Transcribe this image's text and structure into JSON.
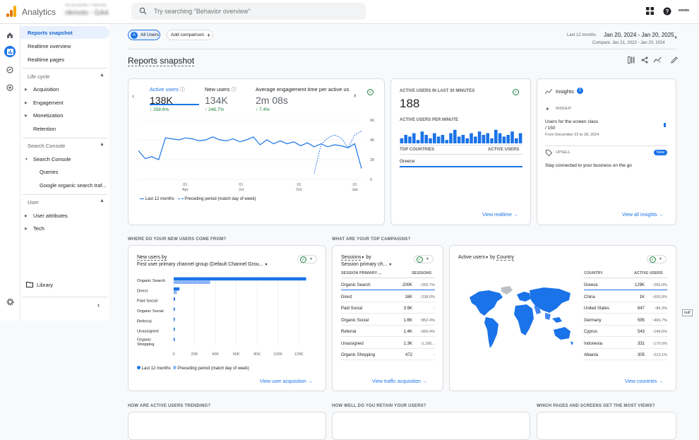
{
  "app": {
    "name": "Analytics",
    "account_line1": "All accounts > nkmoto",
    "account_line2": "nkmoto - GA4"
  },
  "search": {
    "placeholder": "Try searching \"Behavior overview\""
  },
  "topbar": {
    "brand": "emoto"
  },
  "sidebar": {
    "items": [
      "Reports snapshot",
      "Realtime overview",
      "Realtime pages"
    ],
    "sections": [
      {
        "title": "Life cycle",
        "items": [
          "Acquisition",
          "Engagement",
          "Monetization",
          "Retention"
        ]
      },
      {
        "title": "Search Console",
        "items": [
          "Search Console",
          "Queries",
          "Google organic search traf..."
        ]
      },
      {
        "title": "User",
        "items": [
          "User attributes",
          "Tech"
        ]
      }
    ],
    "library": "Library"
  },
  "header": {
    "chip_all_users": "All Users",
    "chip_avatar": "A",
    "add_comparison": "Add comparison",
    "range_label": "Last 12 months",
    "range_main": "Jan 20, 2024 - Jan 20, 2025",
    "range_compare": "Compare: Jan 21, 2023 - Jan 20, 2024",
    "title": "Reports snapshot"
  },
  "overview": {
    "metrics": [
      {
        "label": "Active users",
        "value": "138K",
        "change": "258.6%"
      },
      {
        "label": "New users",
        "value": "134K",
        "change": "248.7%"
      },
      {
        "label": "Average engagement time per active us",
        "value": "2m 08s",
        "change": "7.4%"
      }
    ],
    "legend": [
      "Last 12 months",
      "Preceding period (match day of week)"
    ]
  },
  "chart_data": [
    {
      "type": "line",
      "title": "",
      "series": [
        {
          "name": "Last 12 months",
          "values": [
            2.9,
            2.1,
            2.3,
            2.0,
            4.2,
            4.1,
            4.0,
            4.2,
            4.1,
            3.9,
            4.0,
            4.3,
            4.0,
            3.9,
            4.1,
            3.8,
            4.0,
            4.3,
            3.5,
            4.0,
            3.6,
            3.9,
            3.6,
            3.8,
            3.4,
            3.7,
            3.3,
            3.6,
            3.3,
            3.5,
            3.4,
            3.2,
            3.6,
            1.1
          ]
        },
        {
          "name": "Preceding period (match day of week)",
          "values": [
            null,
            null,
            null,
            null,
            null,
            null,
            null,
            null,
            null,
            null,
            null,
            null,
            null,
            null,
            null,
            null,
            null,
            null,
            null,
            null,
            null,
            null,
            null,
            null,
            null,
            null,
            0.6,
            3.5,
            4.2,
            4.5,
            4.2,
            3.2,
            4.5,
            4.9
          ]
        }
      ],
      "x_ticks": [
        {
          "line1": "01",
          "line2": "Apr"
        },
        {
          "line1": "01",
          "line2": "Jul"
        },
        {
          "line1": "01",
          "line2": "Oct"
        },
        {
          "line1": "01",
          "line2": "Jan"
        }
      ],
      "y_ticks": [
        "6K",
        "4K",
        "2K",
        "0"
      ],
      "ylim": [
        0,
        6
      ]
    },
    {
      "type": "bar",
      "title": "",
      "categories": [
        "Organic Search",
        "Direct",
        "Paid Social",
        "Organic Social",
        "Referral",
        "Unassigned",
        "Organic Shopping"
      ],
      "series": [
        {
          "name": "Last 12 months",
          "values": [
            127000,
            5500,
            1300,
            1100,
            700,
            600,
            300
          ]
        },
        {
          "name": "Preceding period (match day of week)",
          "values": [
            35000,
            3000,
            0,
            0,
            0,
            0,
            0
          ]
        }
      ],
      "x_ticks": [
        "0",
        "20K",
        "40K",
        "60K",
        "80K",
        "100K",
        "120K"
      ],
      "xlim": [
        0,
        130000
      ]
    },
    {
      "type": "bar",
      "title": "",
      "values": [
        3,
        5,
        4,
        6,
        2,
        7,
        5,
        3,
        6,
        4,
        5,
        2,
        6,
        8,
        4,
        5,
        3,
        6,
        4,
        7,
        5,
        6,
        3,
        8,
        6,
        4,
        5,
        7,
        3,
        6
      ],
      "ylim": [
        0,
        10
      ]
    }
  ],
  "realtime": {
    "title": "ACTIVE USERS IN LAST 30 MINUTES",
    "value": "188",
    "per_minute": "ACTIVE USERS PER MINUTE",
    "col1": "TOP COUNTRIES",
    "col2": "ACTIVE USERS",
    "country": "Greece",
    "link": "View realtime"
  },
  "insights": {
    "title": "Insights",
    "badge": "1",
    "insight_label": "INSIGHT",
    "insight_text": "Users for the screen class",
    "insight_value": "/ 150",
    "insight_date": "From December 22 to 28, 2024",
    "upsell_label": "UPSELL",
    "new_badge": "New",
    "upsell_text": "Stay connected to your business on the go",
    "link": "View all insights"
  },
  "new_users": {
    "section": "WHERE DO YOUR NEW USERS COME FROM?",
    "title": "New users by",
    "subtitle": "First user primary channel group (Default Channel Grou...",
    "link": "View user acquisition"
  },
  "campaigns": {
    "section": "WHAT ARE YOUR TOP CAMPAIGNS?",
    "title": "Sessions",
    "by": "by",
    "subtitle": "Session primary ch...",
    "col1": "SESSION PRIMARY ...",
    "col2": "SESSIONS",
    "rows": [
      {
        "name": "Organic Search",
        "value": "200K",
        "change": "265.7%"
      },
      {
        "name": "Direct",
        "value": "16K",
        "change": "238.0%"
      },
      {
        "name": "Paid Social",
        "value": "3.9K",
        "change": "-"
      },
      {
        "name": "Organic Social",
        "value": "1.6K",
        "change": "852.4%"
      },
      {
        "name": "Referral",
        "value": "1.4K",
        "change": "950.4%"
      },
      {
        "name": "Unassigned",
        "value": "1.3K",
        "change": "1,180..."
      },
      {
        "name": "Organic Shopping",
        "value": "472",
        "change": "-"
      }
    ],
    "link": "View traffic acquisition"
  },
  "countries": {
    "title": "Active users",
    "by": "by",
    "dim": "Country",
    "col1": "COUNTRY",
    "col2": "ACTIVE USERS",
    "rows": [
      {
        "name": "Greece",
        "value": "129K",
        "change": "265.0%"
      },
      {
        "name": "China",
        "value": "1K",
        "change": "655.9%"
      },
      {
        "name": "United States",
        "value": "647",
        "change": "86.3%"
      },
      {
        "name": "Germany",
        "value": "595",
        "change": "466.7%"
      },
      {
        "name": "Cyprus",
        "value": "543",
        "change": "146.6%"
      },
      {
        "name": "Indonesia",
        "value": "331",
        "change": "170.0%"
      },
      {
        "name": "Albania",
        "value": "305",
        "change": "213.1%"
      }
    ],
    "link": "View countries"
  },
  "bottom": {
    "s1": "HOW ARE ACTIVE USERS TRENDING?",
    "s2": "HOW WELL DO YOU RETAIN YOUR USERS?",
    "s3": "WHICH PAGES AND SCREENS GET THE MOST VIEWS?"
  },
  "misc": {
    "null_tag": "null"
  },
  "colors": {
    "primary": "#1a73e8",
    "preceding": "#8ab4f8",
    "green": "#188038"
  }
}
